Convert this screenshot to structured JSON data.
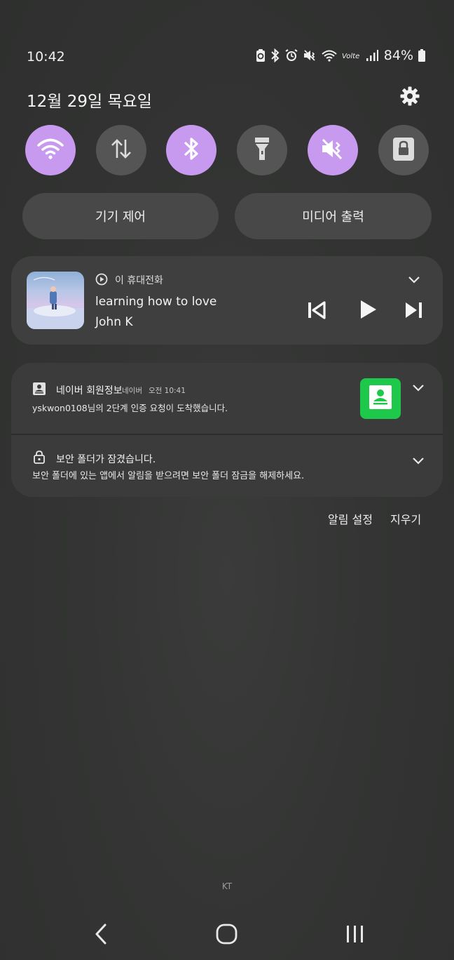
{
  "status_bar": {
    "time": "10:42",
    "battery_percent": "84%",
    "icons": [
      "battery-saver-icon",
      "bluetooth-icon",
      "alarm-icon",
      "mute-icon",
      "wifi-icon",
      "volte-icon",
      "signal-icon",
      "battery-icon"
    ]
  },
  "header": {
    "date": "12월 29일 목요일",
    "settings_icon": "gear-icon"
  },
  "quick_toggles": [
    {
      "name": "wifi",
      "icon": "wifi-icon",
      "state": "on"
    },
    {
      "name": "mobile-data",
      "icon": "data-arrows-icon",
      "state": "off"
    },
    {
      "name": "bluetooth",
      "icon": "bluetooth-icon",
      "state": "on"
    },
    {
      "name": "flashlight",
      "icon": "flashlight-icon",
      "state": "off"
    },
    {
      "name": "sound",
      "icon": "mute-icon",
      "state": "on"
    },
    {
      "name": "secure-folder",
      "icon": "lock-icon",
      "state": "off"
    }
  ],
  "buttons": {
    "device_control": "기기 제어",
    "media_output": "미디어 출력"
  },
  "media": {
    "source": "이 휴대전화",
    "title": "learning how to love",
    "artist": "John K"
  },
  "notifications": {
    "naver": {
      "app": "네이버 회원정보",
      "sub_app": "네이버",
      "time": "오전 10:41",
      "text": "yskwon0108님의 2단계 인증 요청이 도착했습니다."
    },
    "secure_folder": {
      "title": "보안 폴더가 잠겼습니다.",
      "text": "보안 폴더에 있는 앱에서 알림을 받으려면 보안 폴더 잠금을 해제하세요."
    }
  },
  "actions": {
    "notification_settings": "알림 설정",
    "clear": "지우기"
  },
  "carrier": "KT",
  "colors": {
    "toggle_on": "#c79af0",
    "toggle_off": "#545554",
    "naver_green": "#1ec84b"
  }
}
